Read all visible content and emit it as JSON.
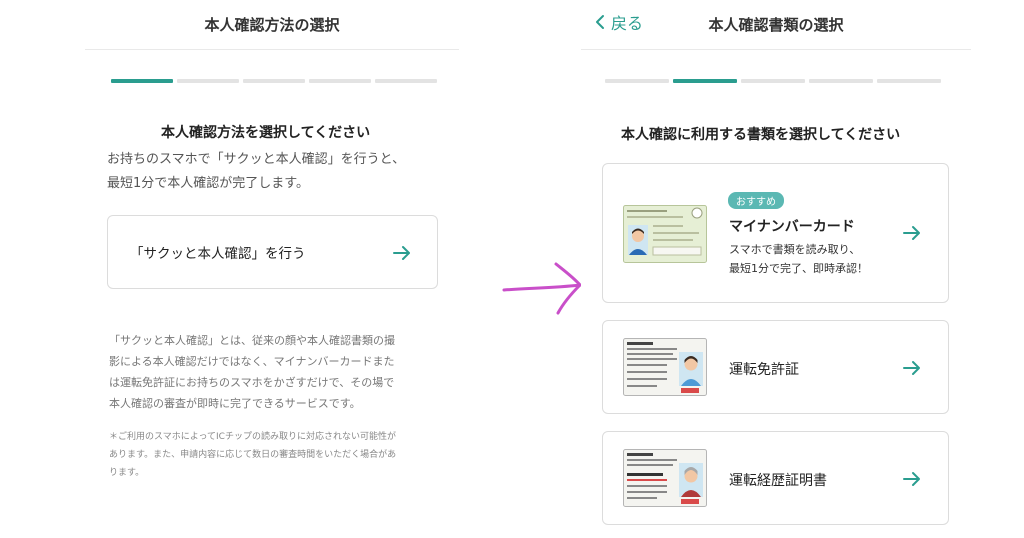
{
  "left": {
    "header_title": "本人確認方法の選択",
    "progress": {
      "steps": 5,
      "current": 1
    },
    "section_title": "本人確認方法を選択してください",
    "description": [
      "お持ちのスマホで「サクッと本人確認」を行うと、",
      "最短1分で本人確認が完了します。"
    ],
    "option_label": "「サクッと本人確認」を行う",
    "note": [
      "「サクッと本人確認」とは、従来の顔や本人確認書類の撮",
      "影による本人確認だけではなく、マイナンバーカードまた",
      "は運転免許証にお持ちのスマホをかざすだけで、その場で",
      "本人確認の審査が即時に完了できるサービスです。"
    ],
    "footnote": [
      "＊ご利用のスマホによってICチップの読み取りに対応されない可能性が",
      "あります。また、申請内容に応じて数日の審査時間をいただく場合があ",
      "ります。"
    ]
  },
  "right": {
    "back_label": "戻る",
    "header_title": "本人確認書類の選択",
    "progress": {
      "steps": 5,
      "current": 2
    },
    "section_title": "本人確認に利用する書類を選択してください",
    "documents": [
      {
        "badge": "おすすめ",
        "label": "マイナンバーカード",
        "description": [
          "スマホで書類を読み取り、",
          "最短1分で完了、即時承認！"
        ],
        "icon": "mynumber-card-icon"
      },
      {
        "label": "運転免許証",
        "icon": "drivers-license-icon"
      },
      {
        "label": "運転経歴証明書",
        "icon": "driving-history-certificate-icon"
      }
    ]
  },
  "colors": {
    "accent": "#2a9d8f",
    "badge": "#5bb8b3",
    "pointer": "#c94fc9"
  }
}
